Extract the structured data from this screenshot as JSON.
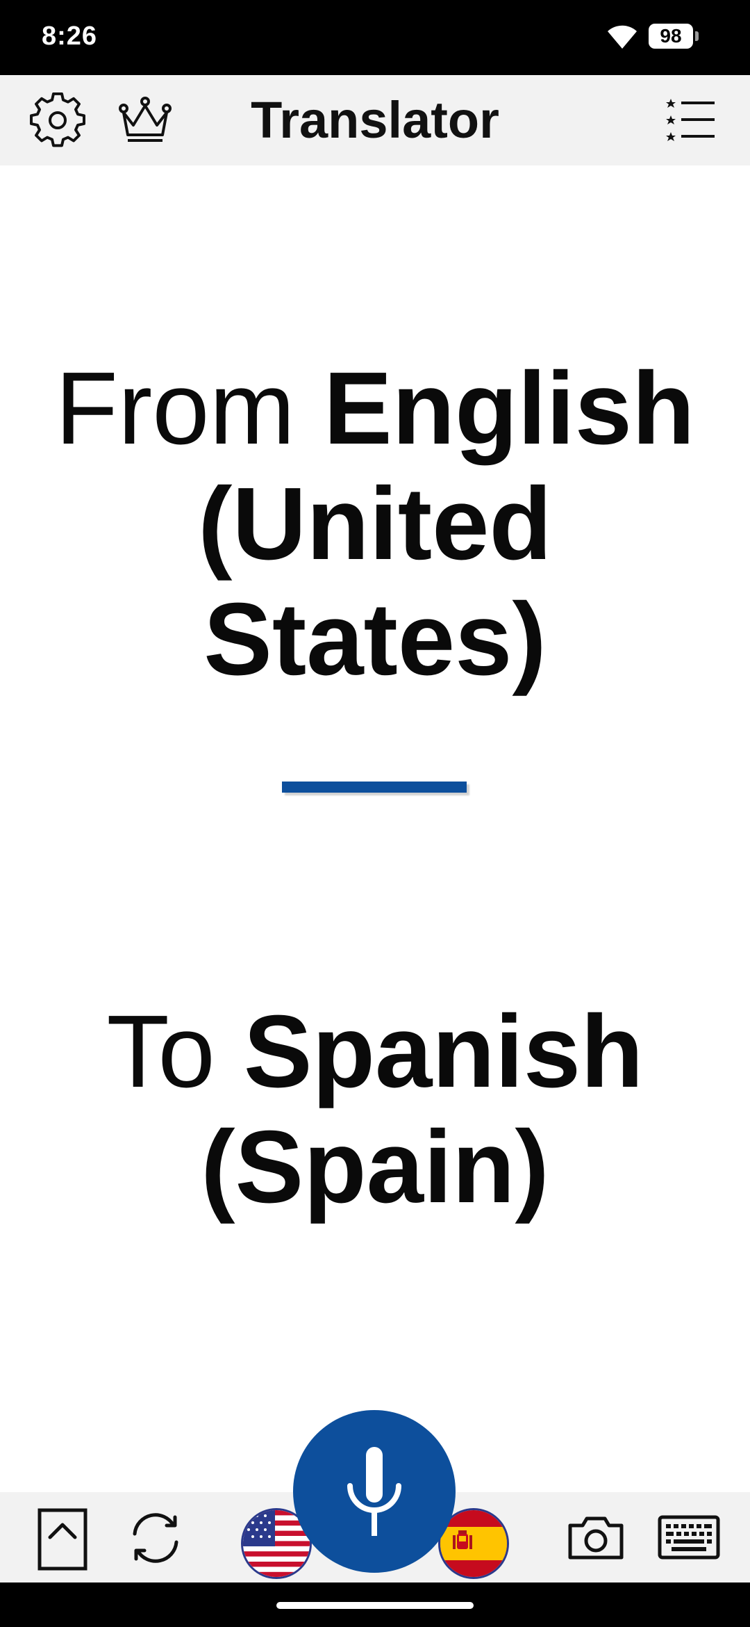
{
  "status_bar": {
    "time": "8:26",
    "battery_level": "98"
  },
  "header": {
    "title": "Translator",
    "icons": {
      "settings": "gear-icon",
      "premium": "crown-icon",
      "favorites": "starred-list-icon"
    }
  },
  "languages": {
    "from_prefix": "From ",
    "from_name": "English (United States)",
    "to_prefix": "To ",
    "to_name": "Spanish (Spain)"
  },
  "toolbar": {
    "icons": {
      "history": "expand-up-icon",
      "swap": "swap-icon",
      "microphone": "microphone-icon",
      "camera": "camera-icon",
      "keyboard": "keyboard-icon"
    },
    "source_flag": "us-flag",
    "target_flag": "spain-flag"
  },
  "colors": {
    "accent": "#0d4f9c",
    "header_background": "#f2f2f2",
    "status_bar": "#000000",
    "text": "#0a0a0a"
  }
}
